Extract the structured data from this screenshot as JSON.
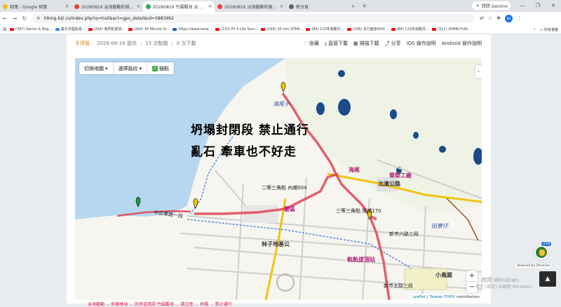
{
  "browser": {
    "tabs": [
      {
        "title": "相簿 - Google 相簿",
        "color": "#fbbc04",
        "active": false
      },
      {
        "title": "20260816 淡海龍動紅樹林站",
        "color": "#ea4335",
        "active": false
      },
      {
        "title": "20260816 竹圍觀海 淡海龍動紅",
        "color": "#34a853",
        "active": true
      },
      {
        "title": "20260816 淡海龍動紅樹林站",
        "color": "#ea4335",
        "active": false
      },
      {
        "title": "新分頁",
        "color": "#5f6368",
        "active": false
      }
    ],
    "new_tab": "+",
    "gemini_label": "問問 Gemini",
    "window_controls": [
      "⌄",
      "—",
      "❐",
      "✕"
    ],
    "url": "hiking.biji.co/index.php?q=trail&act=gpx_detail&id=5883992",
    "bookmarks": [
      {
        "label": "(347) Senior & Beg…",
        "color": "#ff0000"
      },
      {
        "label": "臺北市國民運…",
        "color": "#4285f4"
      },
      {
        "label": "(264) 我們的愛真…",
        "color": "#ff0000"
      },
      {
        "label": "(264) 30 Minute St…",
        "color": "#ff0000"
      },
      {
        "label": "https://www.twse…",
        "color": "#1565c0"
      },
      {
        "label": "(110) Fit 4 Life Seni…",
        "color": "#ff0000"
      },
      {
        "label": "(169) 20 min STAN…",
        "color": "#ff0000"
      },
      {
        "label": "(84) 110年運動月…",
        "color": "#ff0000"
      },
      {
        "label": "(158) 深力健身SHO…",
        "color": "#ff0000"
      },
      {
        "label": "(84) 110年運動月…",
        "color": "#ff0000"
      },
      {
        "label": "(311) 30MIN FUN…",
        "color": "#ff0000"
      }
    ],
    "bookmarks_more": "»",
    "all_bookmarks": "所有書籤"
  },
  "meta": {
    "author": "手得賢",
    "date": "2026-08-16 提供",
    "clicks": "15 次點閱",
    "downloads": "0 次下載",
    "actions": {
      "favorite": "收藏",
      "direct_download": "直接下載",
      "scan_download": "掃描下載",
      "share": "分享",
      "ios_help": "iOS 操作說明",
      "android_help": "Android 操作說明"
    }
  },
  "map": {
    "switch_map": "切換地圖",
    "select_route": "選擇路段",
    "waypoints": "錨點",
    "overlay_line1": "坍塌封閉段 禁止通行",
    "overlay_line2": "亂石  牽車也不好走",
    "zoom_in": "+",
    "zoom_out": "−",
    "attribution_leaflet": "Leaflet",
    "attribution_topo": "Taiwan TOPO",
    "attribution_suffix": "contributors",
    "labels": {
      "haiweizi_top": "海尾子",
      "haiwei": "海尾",
      "huarong": "華榮工廠",
      "beibin": "北濱公路",
      "triangle1": "二等三角點 內補004",
      "triangle2": "三等三角點 陸補170",
      "junqu": "營區",
      "linzi": "林子地基公",
      "guiji": "軌軌拔頂站",
      "tianliao": "田寮仔",
      "xiaoniaowo": "小鳥窩",
      "road1": "中正東路一段",
      "road2": "新市六路三段",
      "road3": "新市五路三段"
    }
  },
  "bottom_text": "淡海龍動 ... 紅樹林站 ... 的步道資訊 竹圍觀海 ... 請注意 ... 坍塌 ... 禁止通行",
  "widgets": {
    "chat_badge": "234",
    "powered": "Powered by Omnilive",
    "to_top": "▲",
    "windows_line1": "啟用 Windows",
    "windows_line2": "移至 [設定] 以啟用 Windows。"
  }
}
